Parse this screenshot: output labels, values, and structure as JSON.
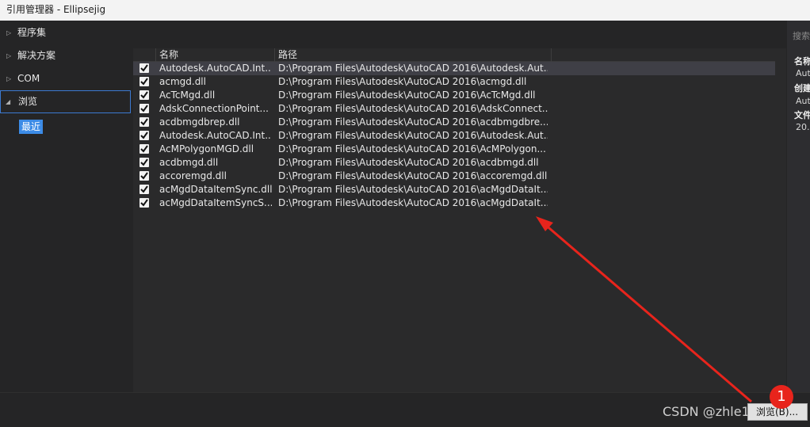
{
  "window": {
    "title": "引用管理器 - Ellipsejig"
  },
  "nav": {
    "items": [
      {
        "label": "程序集",
        "expanded": false
      },
      {
        "label": "解决方案",
        "expanded": false
      },
      {
        "label": "COM",
        "expanded": false
      },
      {
        "label": "浏览",
        "expanded": true
      }
    ],
    "sub_item": "最近"
  },
  "table": {
    "headers": {
      "name": "名称",
      "path": "路径"
    },
    "rows": [
      {
        "checked": true,
        "name": "Autodesk.AutoCAD.Int...",
        "path": "D:\\Program Files\\Autodesk\\AutoCAD 2016\\Autodesk.Aut..."
      },
      {
        "checked": true,
        "name": "acmgd.dll",
        "path": "D:\\Program Files\\Autodesk\\AutoCAD 2016\\acmgd.dll"
      },
      {
        "checked": true,
        "name": "AcTcMgd.dll",
        "path": "D:\\Program Files\\Autodesk\\AutoCAD 2016\\AcTcMgd.dll"
      },
      {
        "checked": true,
        "name": "AdskConnectionPoint...",
        "path": "D:\\Program Files\\Autodesk\\AutoCAD 2016\\AdskConnect..."
      },
      {
        "checked": true,
        "name": "acdbmgdbrep.dll",
        "path": "D:\\Program Files\\Autodesk\\AutoCAD 2016\\acdbmgdbre..."
      },
      {
        "checked": true,
        "name": "Autodesk.AutoCAD.Int...",
        "path": "D:\\Program Files\\Autodesk\\AutoCAD 2016\\Autodesk.Aut..."
      },
      {
        "checked": true,
        "name": "AcMPolygonMGD.dll",
        "path": "D:\\Program Files\\Autodesk\\AutoCAD 2016\\AcMPolygon..."
      },
      {
        "checked": true,
        "name": "acdbmgd.dll",
        "path": "D:\\Program Files\\Autodesk\\AutoCAD 2016\\acdbmgd.dll"
      },
      {
        "checked": true,
        "name": "accoremgd.dll",
        "path": "D:\\Program Files\\Autodesk\\AutoCAD 2016\\accoremgd.dll"
      },
      {
        "checked": true,
        "name": "acMgdDataItemSync.dll",
        "path": "D:\\Program Files\\Autodesk\\AutoCAD 2016\\acMgdDataIt..."
      },
      {
        "checked": true,
        "name": "acMgdDataItemSyncS...",
        "path": "D:\\Program Files\\Autodesk\\AutoCAD 2016\\acMgdDataIt..."
      }
    ]
  },
  "details": {
    "search_placeholder": "搜索",
    "name_label": "名称",
    "name_value": "Aut",
    "created_label": "创建",
    "created_value": "Aut",
    "file_label": "文件",
    "file_value": "20."
  },
  "footer": {
    "browse_button": "浏览(B)..."
  },
  "annotation": {
    "badge_number": "1",
    "watermark": "CSDN @zhle1345",
    "color": "#e8241c"
  },
  "colors": {
    "background": "#252526",
    "selected_row": "#3f3f46",
    "accent": "#3c8be6"
  }
}
